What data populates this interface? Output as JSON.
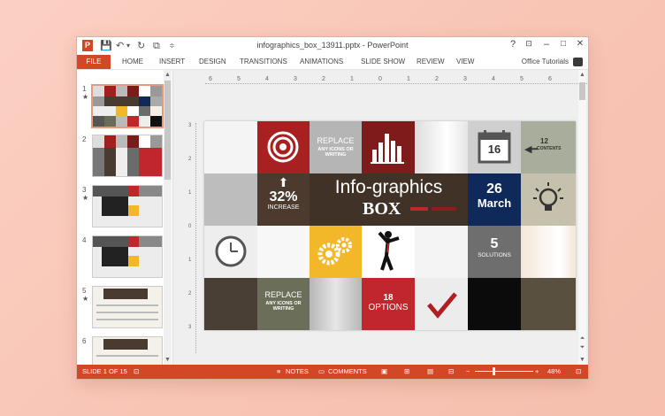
{
  "app": {
    "doc_title": "infographics_box_13911.pptx - PowerPoint",
    "logo_letter": "P",
    "help": "?",
    "minimize": "–",
    "restore": "□",
    "close": "✕"
  },
  "ribbon": {
    "file": "FILE",
    "tabs": [
      "HOME",
      "INSERT",
      "DESIGN",
      "TRANSITIONS",
      "ANIMATIONS",
      "SLIDE SHOW",
      "REVIEW",
      "VIEW"
    ],
    "account": "Office Tutorials"
  },
  "thumbnails": [
    {
      "num": "1",
      "star": "★"
    },
    {
      "num": "2",
      "star": ""
    },
    {
      "num": "3",
      "star": "★"
    },
    {
      "num": "4",
      "star": ""
    },
    {
      "num": "5",
      "star": "★"
    },
    {
      "num": "6",
      "star": ""
    }
  ],
  "ruler": {
    "h_ticks": [
      "6",
      "5",
      "4",
      "3",
      "2",
      "1",
      "0",
      "1",
      "2",
      "3",
      "4",
      "5",
      "6"
    ],
    "v_ticks": [
      "3",
      "2",
      "1",
      "0",
      "1",
      "2",
      "3"
    ]
  },
  "slide": {
    "replace_top": "REPLACE",
    "replace_mid": "ANY ICONS OR",
    "replace_bot": "WRITING",
    "calendar_num": "16",
    "twelve": "12",
    "contents": "CONTENTS",
    "pct": "32%",
    "increase": "INCREASE",
    "title_line1": "Info-graphics",
    "title_line2": "BOX",
    "date_num": "26",
    "date_month": "March",
    "five": "5",
    "solutions": "SOLUTIONS",
    "eighteen": "18",
    "options": "OPTIONS",
    "replace2_top": "REPLACE",
    "replace2_mid": "ANY ICONS OR",
    "replace2_bot": "WRITING"
  },
  "status": {
    "slide_of": "SLIDE 1 OF 15",
    "notes": "NOTES",
    "comments": "COMMENTS",
    "zoom": "48%"
  },
  "colors": {
    "accent": "#d24726",
    "dark_red": "#8e1d1b",
    "red": "#c0272d",
    "navy": "#0f2a5a",
    "olive": "#6b6b5b",
    "yellow": "#f2b829"
  }
}
